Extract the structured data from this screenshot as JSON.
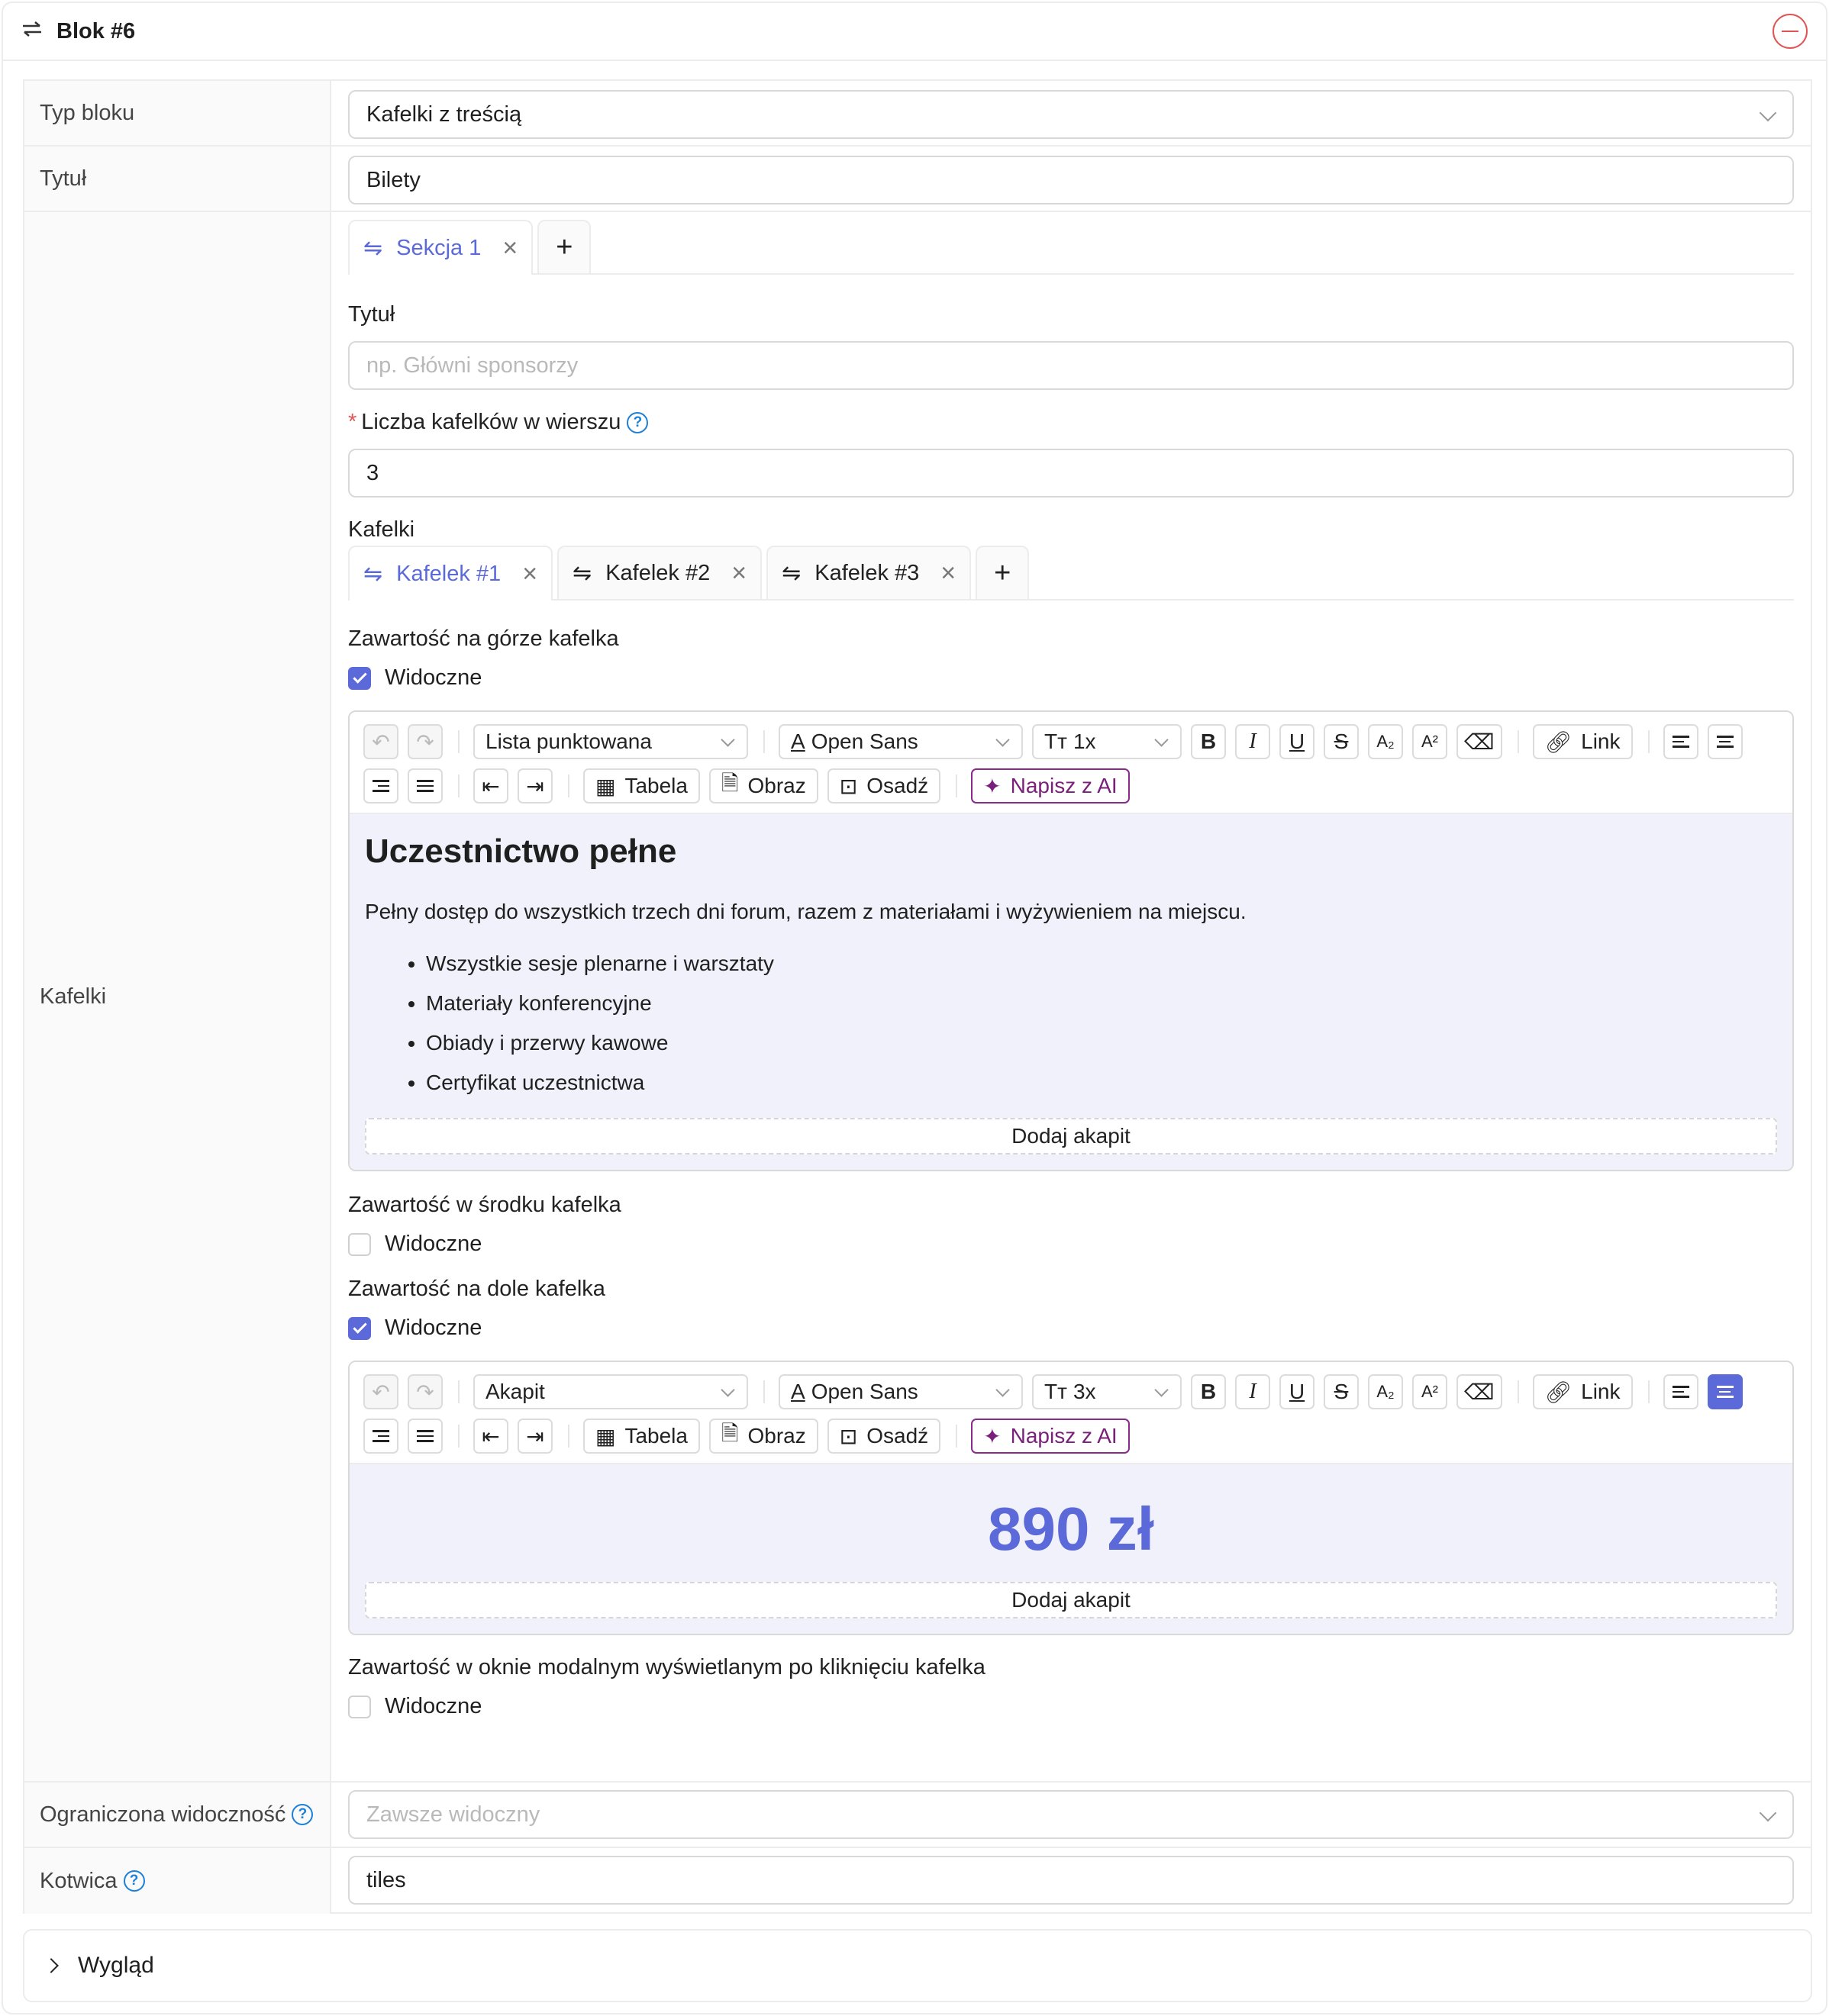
{
  "block": {
    "title": "Blok #6",
    "swap_icon": "swap-icon",
    "remove_icon": "minus-circle-icon"
  },
  "fields": {
    "typ_label": "Typ bloku",
    "typ_value": "Kafelki z treścią",
    "tytul_label": "Tytuł",
    "tytul_value": "Bilety",
    "kafelki_label": "Kafelki",
    "ogr_label": "Ograniczona widoczność",
    "ogr_placeholder": "Zawsze widoczny",
    "kotwica_label": "Kotwica",
    "kotwica_value": "tiles"
  },
  "sections": {
    "tabs": [
      {
        "label": "Sekcja 1"
      }
    ]
  },
  "section": {
    "title_label": "Tytuł",
    "title_placeholder": "np. Główni sponsorzy",
    "count_required": "*",
    "count_label": "Liczba kafelków w wierszu",
    "count_value": "3",
    "tiles_label": "Kafelki",
    "tile_tabs": [
      {
        "label": "Kafelek #1"
      },
      {
        "label": "Kafelek #2"
      },
      {
        "label": "Kafelek #3"
      }
    ]
  },
  "tile": {
    "top_label": "Zawartość na górze kafelka",
    "middle_label": "Zawartość w środku kafelka",
    "bottom_label": "Zawartość na dole kafelka",
    "modal_label": "Zawartość w oknie modalnym wyświetlanym po kliknięciu kafelka",
    "visible_label": "Widoczne",
    "visibility": {
      "top": true,
      "middle": false,
      "bottom": true,
      "modal": false
    }
  },
  "toolbar": {
    "font": "Open Sans",
    "link": "Link",
    "table": "Tabela",
    "image": "Obraz",
    "embed": "Osadź",
    "ai": "Napisz z AI"
  },
  "editor_top": {
    "block_style": "Lista punktowana",
    "size": "1x",
    "heading": "Uczestnictwo pełne",
    "paragraph": "Pełny dostęp do wszystkich trzech dni forum, razem z materiałami i wyżywieniem na miejscu.",
    "bullets": [
      "Wszystkie sesje plenarne i warsztaty",
      "Materiały konferencyjne",
      "Obiady i przerwy kawowe",
      "Certyfikat uczestnictwa"
    ],
    "add_paragraph": "Dodaj akapit"
  },
  "editor_bottom": {
    "block_style": "Akapit",
    "size": "3x",
    "price": "890 zł",
    "add_paragraph": "Dodaj akapit"
  },
  "footer": {
    "label": "Wygląd"
  }
}
